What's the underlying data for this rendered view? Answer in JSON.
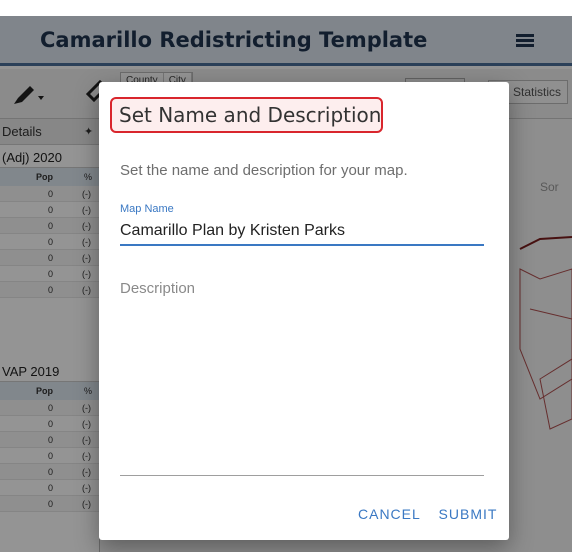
{
  "app": {
    "title": "Camarillo Redistricting Template"
  },
  "toolbar": {
    "tabs": [
      "County",
      "City"
    ],
    "statistics_label": "Statistics"
  },
  "left_panel": {
    "tab_label": "Details",
    "section1": {
      "title": "(Adj) 2020",
      "columns": [
        "Pop",
        "%"
      ],
      "rows": [
        {
          "v": "0",
          "p": "(-)"
        },
        {
          "v": "0",
          "p": "(-)"
        },
        {
          "v": "0",
          "p": "(-)"
        },
        {
          "v": "0",
          "p": "(-)"
        },
        {
          "v": "0",
          "p": "(-)"
        },
        {
          "v": "0",
          "p": "(-)"
        },
        {
          "v": "0",
          "p": "(-)"
        }
      ]
    },
    "section2": {
      "title": "VAP 2019",
      "columns": [
        "Pop",
        "%"
      ],
      "rows": [
        {
          "v": "0",
          "p": "(-)"
        },
        {
          "v": "0",
          "p": "(-)"
        },
        {
          "v": "0",
          "p": "(-)"
        },
        {
          "v": "0",
          "p": "(-)"
        },
        {
          "v": "0",
          "p": "(-)"
        },
        {
          "v": "0",
          "p": "(-)"
        },
        {
          "v": "0",
          "p": "(-)"
        }
      ]
    }
  },
  "map": {
    "partial_label": "Sor"
  },
  "dialog": {
    "title": "Set Name and Description",
    "subtitle": "Set the name and description for your map.",
    "map_name_label": "Map Name",
    "map_name_value": "Camarillo Plan by Kristen Parks",
    "description_placeholder": "Description",
    "description_value": "",
    "cancel_label": "CANCEL",
    "submit_label": "SUBMIT",
    "highlight_color": "#d9262d",
    "accent_color": "#3a78c3"
  }
}
